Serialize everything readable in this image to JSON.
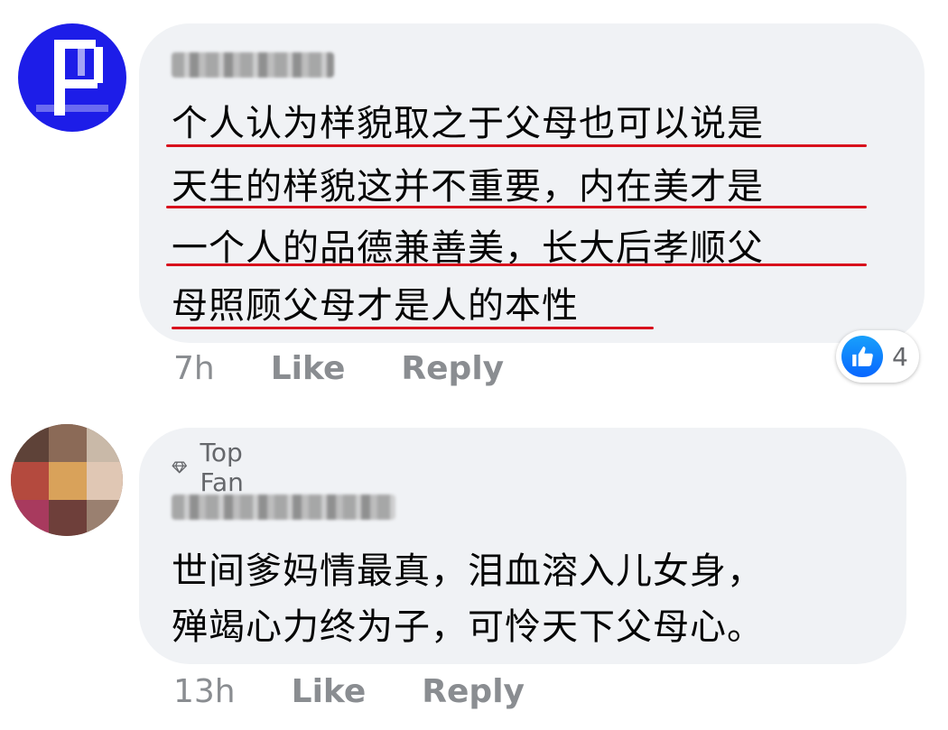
{
  "comments": [
    {
      "author_name": "Peter Lim",
      "lines": [
        "个人认为样貌取之于父母也可以说是",
        "天生的样貌这并不重要，内在美才是",
        "一个人的品德兼善美，长大后孝顺父",
        "母照顾父母才是人的本性"
      ],
      "time": "7h",
      "like_label": "Like",
      "reply_label": "Reply",
      "reaction_count": "4",
      "reaction_icon": "thumbs-up-icon"
    },
    {
      "badge": "Top Fan",
      "badge_icon": "diamond-icon",
      "author_name": "KKai Cheong",
      "lines": [
        "世间爹妈情最真，泪血溶入儿女身，",
        "殚竭心力终为子，可怜天下父母心。"
      ],
      "time": "13h",
      "like_label": "Like",
      "reply_label": "Reply"
    }
  ],
  "colors": {
    "bubble": "#f0f2f5",
    "text": "#050505",
    "meta": "#8a8d91",
    "underline": "#d8101c",
    "like_blue": "#0866ff"
  }
}
